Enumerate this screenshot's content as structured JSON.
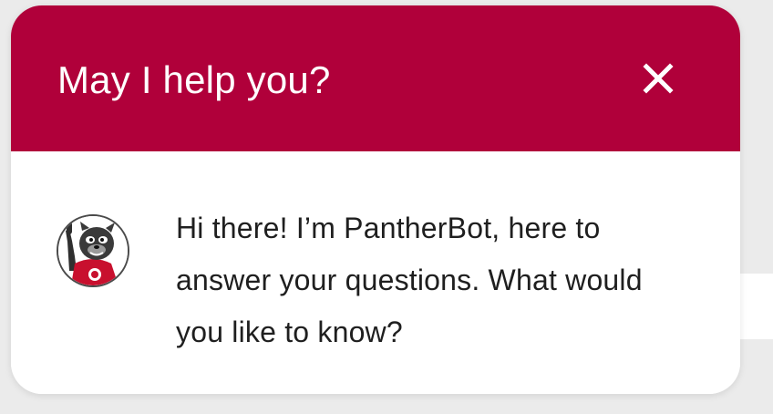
{
  "chat_widget": {
    "header": {
      "title": "May I help you?",
      "close_icon": "close-icon",
      "accent_color": "#b0003a"
    },
    "message": {
      "avatar_icon": "pantherbot-mascot-icon",
      "text": "Hi there! I’m PantherBot, here to answer your questions. What would you like to know?"
    }
  }
}
